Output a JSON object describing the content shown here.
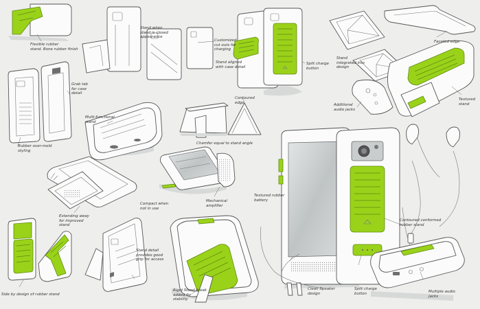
{
  "colors": {
    "accent": "#9ad21a",
    "accent_dark": "#6fa312",
    "ink": "#4a4a4a",
    "paper": "#eeeeec",
    "light_fill": "#fafafa",
    "metal": "#c8cccd"
  },
  "annotations": {
    "a01": "Flexible rubber\nstand. Bone rubber finish",
    "a02": "Stand when\nstand is closed\nappearance",
    "a03": "Customized\ncut outs for\ncharging",
    "a04": "Stand aligned\nwith case detail",
    "a05": "Split charge\nbutton",
    "a06": "Stand\nintegrated into\ndesign",
    "a07": "Faceted edge",
    "a08": "Grab tab\nfor case\ndetail",
    "a09": "Rubber over-mold\nstyling",
    "a10": "Multi-functional\nstand",
    "a11": "Contoured\nedge",
    "a12": "Chamfer equal to stand angle",
    "a13": "Additional\naudio jacks",
    "a14": "Textured\nstand",
    "a15": "Extending away\nfor improved\nstand",
    "a16": "Compact when\nnot in use",
    "a17": "Mechanical\namplifier",
    "a18": "Textured rubber\nbattery",
    "a19": "Contoured conformed\nrubber stand",
    "a20": "Stand detail\nprovides good\ngrip for access",
    "a21": "Rigid Stand break\nadded for\nstability",
    "a22": "Clean Speaker\ndesign",
    "a23": "Split charge\nbutton",
    "a24": "Multiple audio\njacks",
    "a25": "Side by design of rubber stand"
  }
}
